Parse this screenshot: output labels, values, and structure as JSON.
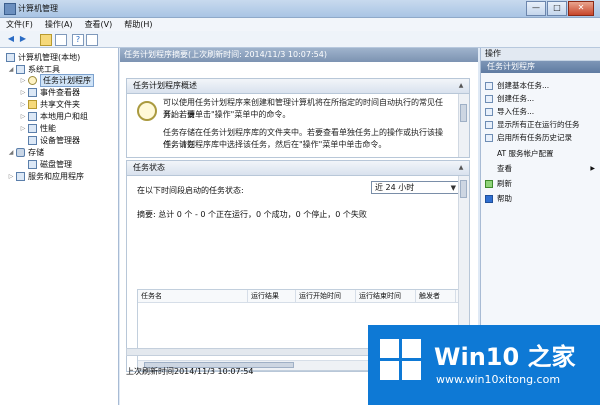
{
  "window": {
    "title": "计算机管理",
    "buttons": {
      "minimize": "—",
      "maximize": "□",
      "close": "✕"
    }
  },
  "menu": [
    "文件(F)",
    "操作(A)",
    "查看(V)",
    "帮助(H)"
  ],
  "tree": [
    {
      "label": "计算机管理(本地)",
      "icon": "computer-icon",
      "level": 0
    },
    {
      "label": "系统工具",
      "icon": "tools-icon",
      "level": 1
    },
    {
      "label": "任务计划程序",
      "icon": "clock-icon",
      "level": 2,
      "selected": true
    },
    {
      "label": "事件查看器",
      "icon": "event-viewer-icon",
      "level": 2
    },
    {
      "label": "共享文件夹",
      "icon": "folder-icon",
      "level": 2
    },
    {
      "label": "本地用户和组",
      "icon": "users-icon",
      "level": 2
    },
    {
      "label": "性能",
      "icon": "performance-icon",
      "level": 2
    },
    {
      "label": "设备管理器",
      "icon": "device-manager-icon",
      "level": 2
    },
    {
      "label": "存储",
      "icon": "storage-icon",
      "level": 1
    },
    {
      "label": "磁盘管理",
      "icon": "disk-icon",
      "level": 2
    },
    {
      "label": "服务和应用程序",
      "icon": "services-icon",
      "level": 1
    }
  ],
  "center": {
    "header": "任务计划程序摘要(上次刷新时间: 2014/11/3 10:07:54)",
    "overview": {
      "title": "任务计划程序概述",
      "para1_line1": "可以使用任务计划程序来创建和管理计算机将在所指定的时间自动执行的常见任务。若要",
      "para1_line2": "开始，请单击\"操作\"菜单中的命令。",
      "para2_line1": "任务存储在任务计划程序库的文件夹中。若要查看单独任务上的操作或执行该操作，请在",
      "para2_line2": "任务计划程序库中选择该任务，然后在\"操作\"菜单中单击命令。"
    },
    "status": {
      "title": "任务状态",
      "range_label": "在以下时间段启动的任务状态:",
      "range_value": "近 24 小时",
      "summary": "摘要: 总计 0 个 - 0 个正在运行，0 个成功，0 个停止，0 个失败",
      "columns": [
        "任务名",
        "运行结果",
        "运行开始时间",
        "运行结束时间",
        "触发者"
      ]
    },
    "footer": "上次刷新时间2014/11/3 10:07:54"
  },
  "actions": {
    "header": "操作",
    "section": "任务计划程序",
    "items": [
      {
        "label": "创建基本任务...",
        "icon": "create-basic-task-icon"
      },
      {
        "label": "创建任务...",
        "icon": "create-task-icon"
      },
      {
        "label": "导入任务...",
        "icon": "import-task-icon"
      },
      {
        "label": "显示所有正在运行的任务",
        "icon": "running-tasks-icon"
      },
      {
        "label": "启用所有任务历史记录",
        "icon": "task-history-icon"
      },
      {
        "label": "AT 服务帐户配置",
        "icon": "none"
      },
      {
        "label": "查看",
        "icon": "none",
        "submenu": "▶"
      },
      {
        "label": "刷新",
        "icon": "refresh-icon"
      },
      {
        "label": "帮助",
        "icon": "help-icon"
      }
    ]
  },
  "watermark": {
    "brand": "Win10 之家",
    "url": "www.win10xitong.com"
  }
}
